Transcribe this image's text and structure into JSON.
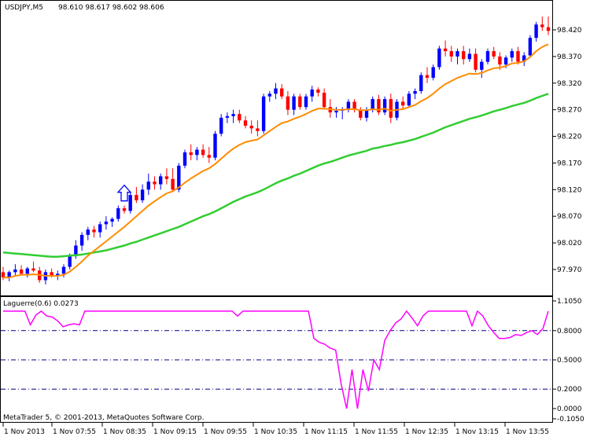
{
  "header": {
    "symbol": "USDJPY,M5",
    "ohlc": "98.610 98.617 98.602 98.606"
  },
  "indicator": {
    "label": "Laguerre(0.6) 0.0273"
  },
  "footer": {
    "copyright": "MetaTrader 5, © 2001-2013, MetaQuotes Software Corp."
  },
  "colors": {
    "bull_candle": "#0000ff",
    "bear_candle": "#ff0000",
    "ma_fast": "#ff8c00",
    "ma_slow": "#32cd32",
    "laguerre": "#ff00ff",
    "level_lines": "#000080",
    "signal_arrow": "#0000ff"
  },
  "chart_data": [
    {
      "type": "candlestick",
      "title": "USDJPY,M5",
      "y_ticks": [
        "98.420",
        "98.370",
        "98.320",
        "98.270",
        "98.220",
        "98.170",
        "98.120",
        "98.070",
        "98.020",
        "97.970"
      ],
      "x_ticks": [
        "1 Nov 2013",
        "1 Nov 07:55",
        "1 Nov 08:35",
        "1 Nov 09:15",
        "1 Nov 09:55",
        "1 Nov 10:35",
        "1 Nov 11:15",
        "1 Nov 11:55",
        "1 Nov 12:35",
        "1 Nov 13:15",
        "1 Nov 13:55"
      ],
      "ylim": [
        97.937,
        98.46
      ],
      "candles": [
        [
          97.965,
          97.975,
          97.95,
          97.955
        ],
        [
          97.955,
          97.968,
          97.948,
          97.965
        ],
        [
          97.965,
          97.98,
          97.958,
          97.97
        ],
        [
          97.97,
          97.978,
          97.96,
          97.962
        ],
        [
          97.962,
          97.975,
          97.955,
          97.972
        ],
        [
          97.972,
          97.985,
          97.965,
          97.968
        ],
        [
          97.968,
          97.975,
          97.945,
          97.95
        ],
        [
          97.95,
          97.97,
          97.942,
          97.965
        ],
        [
          97.965,
          97.972,
          97.955,
          97.958
        ],
        [
          97.958,
          97.968,
          97.95,
          97.962
        ],
        [
          97.962,
          97.98,
          97.955,
          97.975
        ],
        [
          97.975,
          98.0,
          97.97,
          97.995
        ],
        [
          97.995,
          98.025,
          97.99,
          98.015
        ],
        [
          98.015,
          98.04,
          98.005,
          98.035
        ],
        [
          98.035,
          98.05,
          98.025,
          98.045
        ],
        [
          98.045,
          98.052,
          98.03,
          98.04
        ],
        [
          98.04,
          98.06,
          98.03,
          98.055
        ],
        [
          98.055,
          98.07,
          98.045,
          98.06
        ],
        [
          98.06,
          98.068,
          98.05,
          98.065
        ],
        [
          98.065,
          98.09,
          98.06,
          98.085
        ],
        [
          98.085,
          98.09,
          98.075,
          98.08
        ],
        [
          98.08,
          98.115,
          98.075,
          98.11
        ],
        [
          98.11,
          98.125,
          98.095,
          98.1
        ],
        [
          98.1,
          98.13,
          98.095,
          98.12
        ],
        [
          98.12,
          98.15,
          98.11,
          98.135
        ],
        [
          98.135,
          98.145,
          98.12,
          98.13
        ],
        [
          98.13,
          98.15,
          98.12,
          98.145
        ],
        [
          98.145,
          98.16,
          98.13,
          98.14
        ],
        [
          98.14,
          98.16,
          98.115,
          98.12
        ],
        [
          98.12,
          98.17,
          98.115,
          98.165
        ],
        [
          98.165,
          98.195,
          98.16,
          98.19
        ],
        [
          98.19,
          98.205,
          98.175,
          98.185
        ],
        [
          98.185,
          98.2,
          98.175,
          98.195
        ],
        [
          98.195,
          98.205,
          98.18,
          98.185
        ],
        [
          98.185,
          98.2,
          98.17,
          98.18
        ],
        [
          98.18,
          98.23,
          98.175,
          98.225
        ],
        [
          98.225,
          98.262,
          98.22,
          98.255
        ],
        [
          98.255,
          98.265,
          98.245,
          98.258
        ],
        [
          98.258,
          98.27,
          98.245,
          98.262
        ],
        [
          98.262,
          98.27,
          98.245,
          98.25
        ],
        [
          98.25,
          98.258,
          98.235,
          98.24
        ],
        [
          98.24,
          98.25,
          98.225,
          98.235
        ],
        [
          98.235,
          98.25,
          98.22,
          98.23
        ],
        [
          98.23,
          98.3,
          98.225,
          98.295
        ],
        [
          98.295,
          98.305,
          98.285,
          98.3
        ],
        [
          98.3,
          98.32,
          98.29,
          98.31
        ],
        [
          98.31,
          98.318,
          98.29,
          98.295
        ],
        [
          98.295,
          98.305,
          98.26,
          98.27
        ],
        [
          98.27,
          98.3,
          98.26,
          98.295
        ],
        [
          98.295,
          98.3,
          98.27,
          98.275
        ],
        [
          98.275,
          98.3,
          98.27,
          98.295
        ],
        [
          98.295,
          98.315,
          98.285,
          98.308
        ],
        [
          98.308,
          98.312,
          98.295,
          98.302
        ],
        [
          98.302,
          98.31,
          98.27,
          98.275
        ],
        [
          98.275,
          98.29,
          98.255,
          98.265
        ],
        [
          98.265,
          98.275,
          98.255,
          98.268
        ],
        [
          98.268,
          98.275,
          98.252,
          98.27
        ],
        [
          98.27,
          98.29,
          98.265,
          98.285
        ],
        [
          98.285,
          98.29,
          98.265,
          98.27
        ],
        [
          98.27,
          98.275,
          98.25,
          98.255
        ],
        [
          98.255,
          98.275,
          98.248,
          98.27
        ],
        [
          98.27,
          98.295,
          98.265,
          98.29
        ],
        [
          98.29,
          98.298,
          98.26,
          98.265
        ],
        [
          98.265,
          98.295,
          98.26,
          98.29
        ],
        [
          98.29,
          98.3,
          98.245,
          98.255
        ],
        [
          98.255,
          98.29,
          98.25,
          98.285
        ],
        [
          98.285,
          98.295,
          98.27,
          98.278
        ],
        [
          98.278,
          98.305,
          98.275,
          98.3
        ],
        [
          98.3,
          98.31,
          98.29,
          98.305
        ],
        [
          98.305,
          98.34,
          98.3,
          98.335
        ],
        [
          98.335,
          98.35,
          98.32,
          98.33
        ],
        [
          98.33,
          98.355,
          98.325,
          98.35
        ],
        [
          98.35,
          98.39,
          98.345,
          98.385
        ],
        [
          98.385,
          98.4,
          98.37,
          98.38
        ],
        [
          98.38,
          98.39,
          98.36,
          98.37
        ],
        [
          98.37,
          98.385,
          98.355,
          98.38
        ],
        [
          98.38,
          98.39,
          98.355,
          98.365
        ],
        [
          98.365,
          98.385,
          98.36,
          98.375
        ],
        [
          98.375,
          98.385,
          98.34,
          98.345
        ],
        [
          98.345,
          98.365,
          98.33,
          98.36
        ],
        [
          98.36,
          98.385,
          98.355,
          98.38
        ],
        [
          98.38,
          98.388,
          98.365,
          98.37
        ],
        [
          98.37,
          98.378,
          98.345,
          98.355
        ],
        [
          98.355,
          98.372,
          98.348,
          98.368
        ],
        [
          98.368,
          98.385,
          98.36,
          98.38
        ],
        [
          98.38,
          98.388,
          98.355,
          98.36
        ],
        [
          98.36,
          98.378,
          98.352,
          98.372
        ],
        [
          98.372,
          98.41,
          98.368,
          98.405
        ],
        [
          98.405,
          98.435,
          98.398,
          98.43
        ],
        [
          98.43,
          98.445,
          98.418,
          98.425
        ],
        [
          98.425,
          98.445,
          98.41,
          98.418
        ]
      ],
      "ma_fast": [
        97.955,
        97.955,
        97.958,
        97.96,
        97.96,
        97.961,
        97.96,
        97.958,
        97.958,
        97.958,
        97.96,
        97.966,
        97.975,
        97.985,
        97.996,
        98.005,
        98.014,
        98.023,
        98.032,
        98.041,
        98.05,
        98.06,
        98.07,
        98.08,
        98.09,
        98.098,
        98.106,
        98.113,
        98.117,
        98.124,
        98.133,
        98.141,
        98.148,
        98.155,
        98.16,
        98.168,
        98.178,
        98.188,
        98.197,
        98.204,
        98.209,
        98.212,
        98.214,
        98.222,
        98.23,
        98.238,
        98.245,
        98.248,
        98.253,
        98.257,
        98.262,
        98.268,
        98.272,
        98.272,
        98.271,
        98.27,
        98.27,
        98.271,
        98.271,
        98.269,
        98.269,
        98.271,
        98.27,
        98.272,
        98.268,
        98.27,
        98.271,
        98.275,
        98.279,
        98.286,
        98.292,
        98.3,
        98.31,
        98.318,
        98.324,
        98.33,
        98.334,
        98.338,
        98.337,
        98.339,
        98.344,
        98.348,
        98.349,
        98.352,
        98.357,
        98.358,
        98.361,
        98.369,
        98.38,
        98.388,
        98.393
      ],
      "ma_slow": [
        98.002,
        98.001,
        98.0,
        97.999,
        97.998,
        97.997,
        97.996,
        97.995,
        97.994,
        97.994,
        97.995,
        97.996,
        97.997,
        97.998,
        98.0,
        98.002,
        98.004,
        98.006,
        98.009,
        98.012,
        98.015,
        98.019,
        98.022,
        98.026,
        98.03,
        98.034,
        98.038,
        98.042,
        98.046,
        98.05,
        98.055,
        98.06,
        98.065,
        98.07,
        98.074,
        98.079,
        98.085,
        98.091,
        98.097,
        98.102,
        98.107,
        98.111,
        98.115,
        98.12,
        98.126,
        98.132,
        98.137,
        98.141,
        98.146,
        98.15,
        98.155,
        98.16,
        98.165,
        98.169,
        98.172,
        98.176,
        98.18,
        98.184,
        98.187,
        98.19,
        98.193,
        98.197,
        98.199,
        98.202,
        98.204,
        98.207,
        98.209,
        98.212,
        98.215,
        98.219,
        98.223,
        98.227,
        98.232,
        98.237,
        98.241,
        98.245,
        98.249,
        98.253,
        98.256,
        98.259,
        98.263,
        98.267,
        98.27,
        98.273,
        98.277,
        98.28,
        98.283,
        98.287,
        98.292,
        98.296,
        98.3
      ],
      "signal_arrow": {
        "bar": 20,
        "direction": "up"
      }
    },
    {
      "type": "line",
      "title": "Laguerre(0.6) 0.0273",
      "y_ticks": [
        "1.1050",
        "0.8000",
        "0.5000",
        "0.2000",
        "0.0000",
        "-0.1050"
      ],
      "levels": [
        0.8,
        0.5,
        0.2
      ],
      "ylim": [
        -0.105,
        1.105
      ],
      "values": [
        1.0,
        1.0,
        1.0,
        1.0,
        1.0,
        0.86,
        0.96,
        1.0,
        0.95,
        0.94,
        0.9,
        0.84,
        0.86,
        0.87,
        0.86,
        1.0,
        1.0,
        1.0,
        1.0,
        1.0,
        1.0,
        1.0,
        1.0,
        1.0,
        1.0,
        1.0,
        1.0,
        1.0,
        1.0,
        1.0,
        1.0,
        1.0,
        1.0,
        1.0,
        1.0,
        1.0,
        1.0,
        1.0,
        1.0,
        1.0,
        1.0,
        1.0,
        1.0,
        0.95,
        1.0,
        1.0,
        1.0,
        1.0,
        1.0,
        1.0,
        1.0,
        1.0,
        1.0,
        1.0,
        1.0,
        1.0,
        1.0,
        0.72,
        0.68,
        0.66,
        0.62,
        0.6,
        0.25,
        0.0,
        0.4,
        0.0,
        0.4,
        0.18,
        0.5,
        0.4,
        0.7,
        0.8,
        0.88,
        0.92,
        1.0,
        0.93,
        0.85,
        0.95,
        1.0,
        1.0,
        1.0,
        1.0,
        1.0,
        1.0,
        1.0,
        1.0,
        0.85,
        1.0,
        0.95,
        0.85,
        0.78,
        0.72,
        0.72,
        0.73,
        0.76,
        0.75,
        0.78,
        0.8,
        0.76,
        0.82,
        1.0
      ]
    }
  ]
}
